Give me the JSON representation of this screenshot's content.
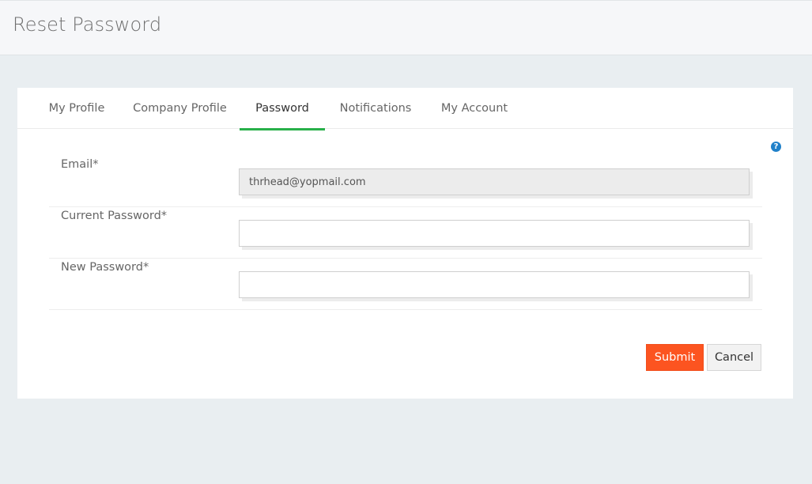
{
  "header": {
    "title": "Reset Password"
  },
  "tabs": [
    {
      "label": "My Profile"
    },
    {
      "label": "Company Profile"
    },
    {
      "label": "Password",
      "active": true
    },
    {
      "label": "Notifications"
    },
    {
      "label": "My Account"
    }
  ],
  "help_icon": {
    "glyph": "?",
    "name": "help-icon"
  },
  "form": {
    "email": {
      "label": "Email*",
      "value": "thrhead@yopmail.com"
    },
    "current_password": {
      "label": "Current Password*",
      "value": ""
    },
    "new_password": {
      "label": "New Password*",
      "value": ""
    }
  },
  "actions": {
    "submit_label": "Submit",
    "cancel_label": "Cancel"
  },
  "colors": {
    "accent_tab": "#28b04a",
    "submit_bg": "#fc5420",
    "help_icon": "#1f80c9"
  }
}
